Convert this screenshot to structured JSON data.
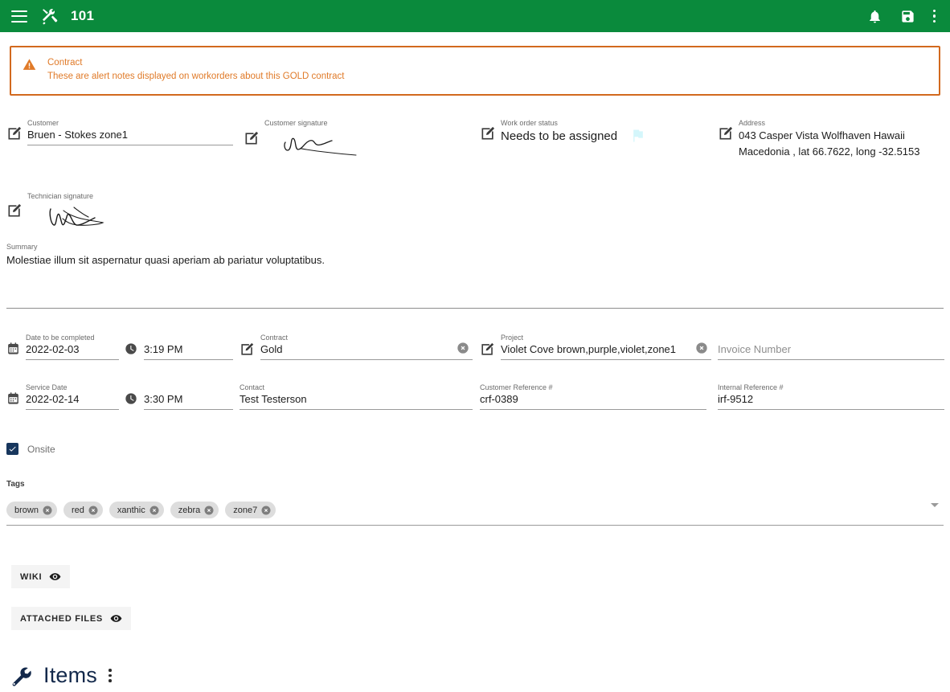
{
  "appbar": {
    "menu_icon": "hamburger-icon",
    "brand_icon": "tools-icon",
    "title": "101",
    "notification_icon": "bell-icon",
    "save_icon": "save-icon",
    "overflow_icon": "kebab-menu-icon",
    "background_color": "#0a8a3c"
  },
  "alert": {
    "icon": "warning-triangle-icon",
    "title": "Contract",
    "message": "These are alert notes displayed on workorders about this GOLD contract",
    "border_color": "#d2691e",
    "text_color": "#e07a28"
  },
  "summary_section": {
    "customer": {
      "label": "Customer",
      "value": "Bruen - Stokes zone1",
      "icon": "edit-icon"
    },
    "customer_signature": {
      "label": "Customer signature",
      "icon": "edit-icon",
      "signature": "signature-scribble"
    },
    "work_order_status": {
      "label": "Work order status",
      "value": "Needs to be assigned",
      "icon": "edit-icon",
      "flag_icon": "flag-icon",
      "flag_color": "#d4f6fb"
    },
    "address": {
      "label": "Address",
      "value": "043 Casper Vista Wolfhaven Hawaii Macedonia , lat 66.7622, long -32.5153",
      "icon": "edit-icon"
    },
    "technician_signature": {
      "label": "Technician signature",
      "icon": "edit-icon",
      "signature": "signature-scribble"
    },
    "summary": {
      "label": "Summary",
      "value": "Molestiae illum sit aspernatur quasi aperiam ab pariatur voluptatibus."
    }
  },
  "details_section": {
    "date_to_be_completed": {
      "label": "Date to be completed",
      "value": "2022-02-03",
      "icon": "calendar-icon"
    },
    "date_to_be_completed_time": {
      "value": "3:19 PM",
      "icon": "clock-icon"
    },
    "contract": {
      "label": "Contract",
      "value": "Gold",
      "icon": "edit-icon",
      "clear_icon": "clear-circle-icon"
    },
    "project": {
      "label": "Project",
      "value": "Violet Cove brown,purple,violet,zone1",
      "icon": "edit-icon",
      "clear_icon": "clear-circle-icon"
    },
    "invoice_number": {
      "label": "",
      "placeholder": "Invoice Number",
      "value": ""
    },
    "service_date": {
      "label": "Service Date",
      "value": "2022-02-14",
      "icon": "calendar-icon"
    },
    "service_date_time": {
      "value": "3:30 PM",
      "icon": "clock-icon"
    },
    "contact": {
      "label": "Contact",
      "value": "Test Testerson"
    },
    "customer_reference": {
      "label": "Customer Reference #",
      "value": "crf-0389"
    },
    "internal_reference": {
      "label": "Internal Reference #",
      "value": "irf-9512"
    }
  },
  "onsite": {
    "label": "Onsite",
    "checked": true,
    "check_color": "#17365d"
  },
  "tags": {
    "label": "Tags",
    "items": [
      {
        "label": "brown"
      },
      {
        "label": "red"
      },
      {
        "label": "xanthic"
      },
      {
        "label": "zebra"
      },
      {
        "label": "zone7"
      }
    ],
    "dropdown_icon": "chevron-down-icon"
  },
  "panels": [
    {
      "label": "WIKI",
      "icon": "eye-icon"
    },
    {
      "label": "ATTACHED FILES",
      "icon": "eye-icon"
    }
  ],
  "items_section": {
    "icon": "wrench-icon",
    "title": "Items",
    "overflow_icon": "kebab-menu-icon",
    "accent_color": "#13294b"
  }
}
